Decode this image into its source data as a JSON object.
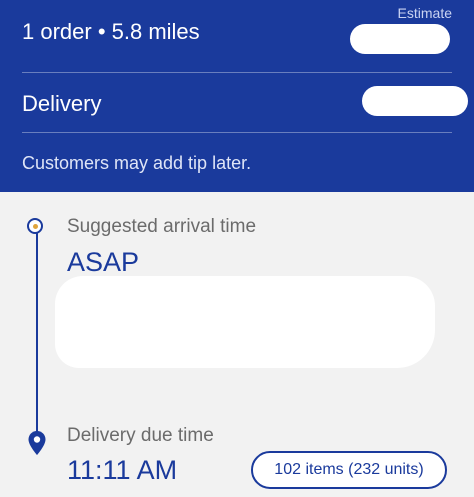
{
  "header": {
    "estimate_label": "Estimate",
    "order_summary": "1 order • 5.8 miles",
    "delivery_label": "Delivery",
    "tip_note": "Customers may add tip later."
  },
  "timeline": {
    "suggested_label": "Suggested arrival time",
    "suggested_value": "ASAP",
    "due_label": "Delivery due time",
    "due_value": "11:11 AM",
    "items_badge": "102 items (232 units)"
  },
  "colors": {
    "brand_blue": "#1a3a9c",
    "accent_orange": "#e0a43a",
    "background": "#f2f2f2"
  },
  "icons": [
    "start-dot-icon",
    "location-pin-icon"
  ]
}
